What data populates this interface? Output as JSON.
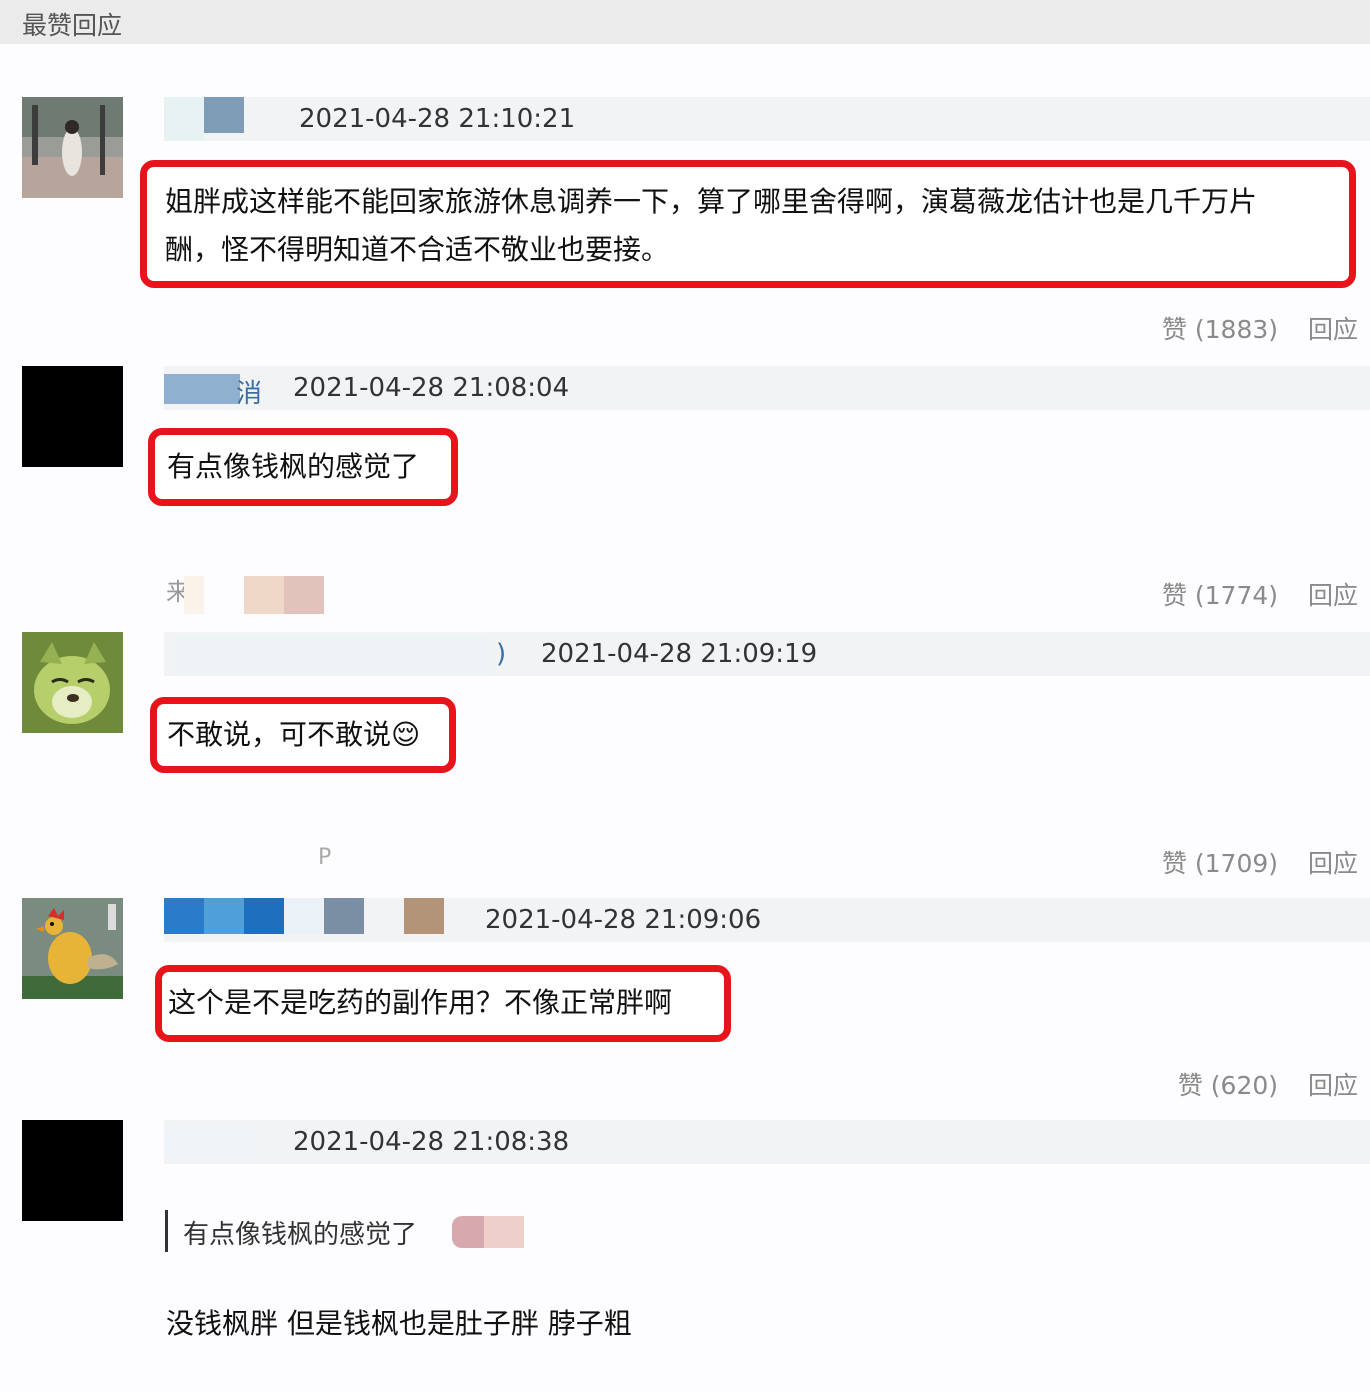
{
  "header": {
    "title": "最赞回应"
  },
  "comments": [
    {
      "time": "2021-04-28 21:10:21",
      "text_line1": "姐胖成这样能不能回家旅游休息调养一下，算了哪里舍得啊，演葛薇龙估计也是几千万片",
      "text_line2": "酬，怪不得明知道不合适不敬业也要接。",
      "like": "赞 (1883)",
      "reply": "回应"
    },
    {
      "name_fragment": "消",
      "time": "2021-04-28 21:08:04",
      "text": "有点像钱枫的感觉了",
      "like": "赞 (1774)",
      "reply": "回应",
      "footer_fragment": "来"
    },
    {
      "name_fragment": ")",
      "time": "2021-04-28 21:09:19",
      "text": "不敢说，可不敢说",
      "emoji": "😌",
      "like": "赞 (1709)",
      "reply": "回应",
      "footer_fragment": "P"
    },
    {
      "time": "2021-04-28 21:09:06",
      "text": "这个是不是吃药的副作用？不像正常胖啊",
      "like": "赞 (620)",
      "reply": "回应"
    },
    {
      "time": "2021-04-28 21:08:38",
      "quote": "有点像钱枫的感觉了",
      "text": "没钱枫胖 但是钱枫也是肚子胖 脖子粗"
    }
  ]
}
